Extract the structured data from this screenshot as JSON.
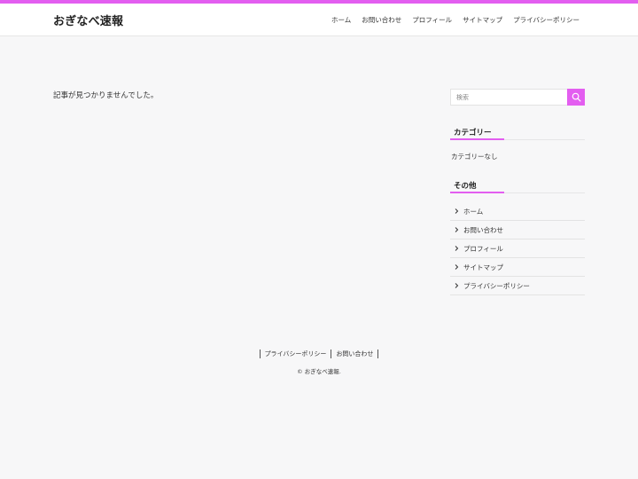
{
  "colors": {
    "accent": "#e35ef0"
  },
  "header": {
    "site_title": "おぎなべ速報",
    "nav": [
      {
        "label": "ホーム"
      },
      {
        "label": "お問い合わせ"
      },
      {
        "label": "プロフィール"
      },
      {
        "label": "サイトマップ"
      },
      {
        "label": "プライバシーポリシー"
      }
    ]
  },
  "main": {
    "message": "記事が見つかりませんでした。"
  },
  "sidebar": {
    "search": {
      "placeholder": "検索",
      "icon": "search-icon"
    },
    "categories": {
      "title": "カテゴリー",
      "empty_text": "カテゴリーなし"
    },
    "other": {
      "title": "その他",
      "items": [
        {
          "label": "ホーム"
        },
        {
          "label": "お問い合わせ"
        },
        {
          "label": "プロフィール"
        },
        {
          "label": "サイトマップ"
        },
        {
          "label": "プライバシーポリシー"
        }
      ]
    }
  },
  "footer": {
    "links": [
      {
        "label": "プライバシーポリシー"
      },
      {
        "label": "お問い合わせ"
      }
    ],
    "copyright": "© おぎなべ速報."
  }
}
